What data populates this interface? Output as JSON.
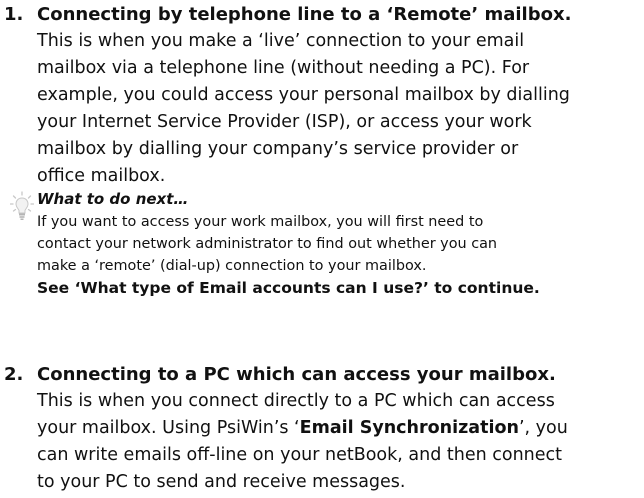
{
  "sections": [
    {
      "number": "1.",
      "heading": "Connecting by telephone line to a ‘Remote’ mailbox.",
      "body_lines": [
        "This is when you make a ‘live’ connection to your email",
        "mailbox via a telephone line (without needing a PC). For",
        "example, you could access your personal mailbox by dialling",
        "your Internet Service Provider (ISP), or access your work",
        "mailbox by dialling your company’s service provider or",
        "office mailbox."
      ],
      "tip": {
        "icon": "lightbulb-icon",
        "heading": "What to do next…",
        "body_lines": [
          "If you want to access your work mailbox, you will first need to",
          "contact your network administrator to find out whether you can",
          "make a ‘remote’ (dial-up) connection to your mailbox."
        ],
        "continue_text": "See ‘What type of Email accounts can I use?’ to continue."
      }
    },
    {
      "number": "2.",
      "heading": "Connecting to a PC which can access your mailbox.",
      "body_line_1": "This is when you connect directly to a PC which can access",
      "body_line_2_before": "your mailbox. Using PsiWin’s ‘",
      "body_line_2_bold": "Email Synchronization",
      "body_line_2_after": "’, you",
      "body_line_3": "can write emails off-line on your netBook, and then connect",
      "body_line_4": "to your PC to send and receive messages."
    }
  ]
}
